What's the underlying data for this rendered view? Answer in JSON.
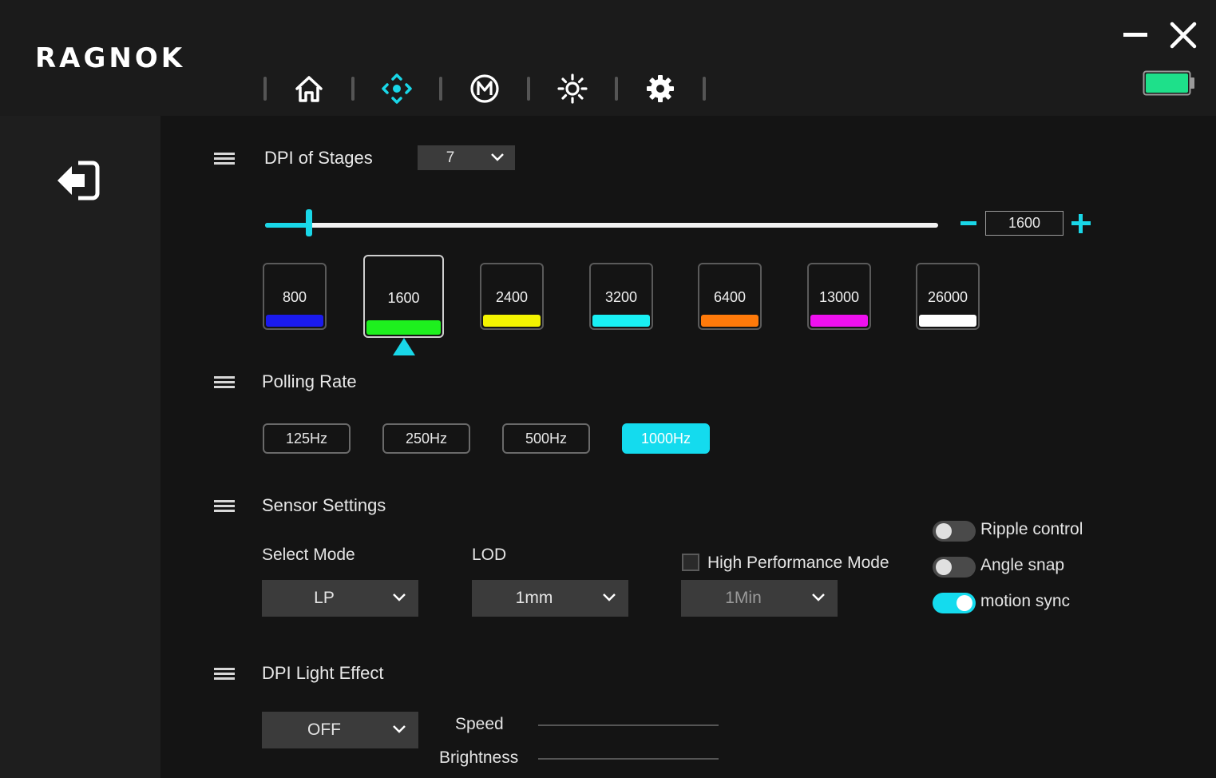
{
  "app": {
    "logo": "RAGNOK"
  },
  "nav": {
    "items": [
      "home-icon",
      "dpi-crosshair-icon",
      "macro-m-icon",
      "light-sun-icon",
      "settings-gear-icon"
    ],
    "active_index": 1,
    "accent": "#19d7e8"
  },
  "window": {
    "battery_color": "#1ee08a"
  },
  "dpi": {
    "title": "DPI of Stages",
    "stages_count": "7",
    "current_value": "1600",
    "slider_fraction": 0.065,
    "stages": [
      {
        "value": "800",
        "color": "#1a1aee"
      },
      {
        "value": "1600",
        "color": "#1ef01e"
      },
      {
        "value": "2400",
        "color": "#f4f400"
      },
      {
        "value": "3200",
        "color": "#19f0f4"
      },
      {
        "value": "6400",
        "color": "#ff7a0a"
      },
      {
        "value": "13000",
        "color": "#ee10ee"
      },
      {
        "value": "26000",
        "color": "#ffffff"
      }
    ],
    "selected_index": 1
  },
  "polling": {
    "title": "Polling Rate",
    "options": [
      "125Hz",
      "250Hz",
      "500Hz",
      "1000Hz"
    ],
    "active_index": 3
  },
  "sensor": {
    "title": "Sensor Settings",
    "select_mode_label": "Select Mode",
    "select_mode_value": "LP",
    "lod_label": "LOD",
    "lod_value": "1mm",
    "high_perf_label": "High Performance Mode",
    "high_perf_checked": false,
    "high_perf_value": "1Min",
    "toggles": [
      {
        "label": "Ripple control",
        "on": false
      },
      {
        "label": "Angle snap",
        "on": false
      },
      {
        "label": "motion sync",
        "on": true
      }
    ]
  },
  "light": {
    "title": "DPI Light Effect",
    "mode_value": "OFF",
    "speed_label": "Speed",
    "brightness_label": "Brightness"
  }
}
